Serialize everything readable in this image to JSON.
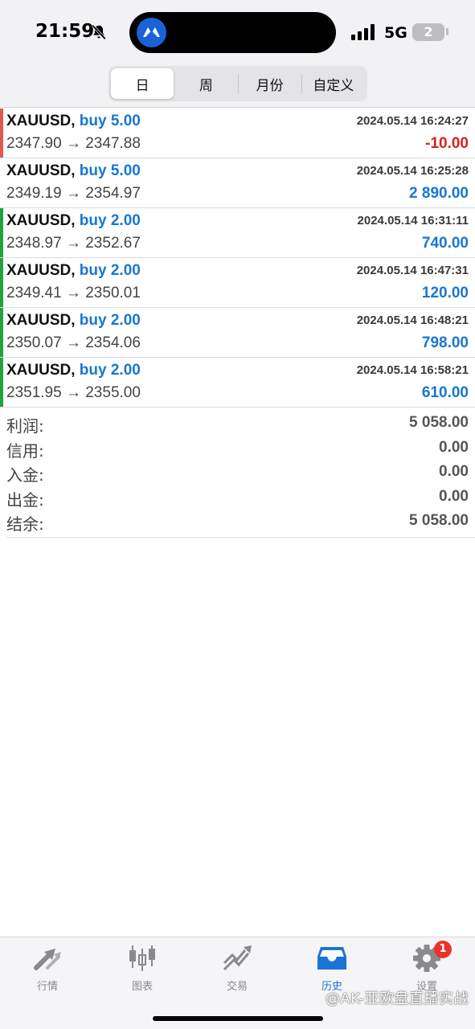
{
  "status_bar": {
    "time": "21:59",
    "network": "5G",
    "battery": "2",
    "icons": [
      "bell-slash-icon",
      "app-logo-icon",
      "signal-icon"
    ]
  },
  "period_tabs": {
    "items": [
      "日",
      "周",
      "月份",
      "自定义"
    ],
    "selected": "日"
  },
  "deals": [
    {
      "symbol": "XAUUSD,",
      "side": "buy 5.00",
      "time": "2024.05.14 16:24:27",
      "prices": "2347.90 → 2347.88",
      "profit": "-10.00",
      "bar_color": "#e05a4f",
      "negative": true
    },
    {
      "symbol": "XAUUSD,",
      "side": "buy 5.00",
      "time": "2024.05.14 16:25:28",
      "prices": "2349.19 → 2354.97",
      "profit": "2 890.00",
      "bar_color": "",
      "negative": false
    },
    {
      "symbol": "XAUUSD,",
      "side": "buy 2.00",
      "time": "2024.05.14 16:31:11",
      "prices": "2348.97 → 2352.67",
      "profit": "740.00",
      "bar_color": "#22a33a",
      "negative": false
    },
    {
      "symbol": "XAUUSD,",
      "side": "buy 2.00",
      "time": "2024.05.14 16:47:31",
      "prices": "2349.41 → 2350.01",
      "profit": "120.00",
      "bar_color": "#22a33a",
      "negative": false
    },
    {
      "symbol": "XAUUSD,",
      "side": "buy 2.00",
      "time": "2024.05.14 16:48:21",
      "prices": "2350.07 → 2354.06",
      "profit": "798.00",
      "bar_color": "#22a33a",
      "negative": false
    },
    {
      "symbol": "XAUUSD,",
      "side": "buy 2.00",
      "time": "2024.05.14 16:58:21",
      "prices": "2351.95 → 2355.00",
      "profit": "610.00",
      "bar_color": "#22a33a",
      "negative": false
    }
  ],
  "summary": [
    {
      "label": "利润:",
      "value": "5 058.00"
    },
    {
      "label": "信用:",
      "value": "0.00"
    },
    {
      "label": "入金:",
      "value": "0.00"
    },
    {
      "label": "出金:",
      "value": "0.00"
    },
    {
      "label": "结余:",
      "value": "5 058.00"
    }
  ],
  "tab_bar": {
    "items": [
      {
        "label": "行情",
        "icon": "quotes-arrows-icon"
      },
      {
        "label": "图表",
        "icon": "candlestick-chart-icon"
      },
      {
        "label": "交易",
        "icon": "trade-trend-icon"
      },
      {
        "label": "历史",
        "icon": "history-inbox-icon"
      },
      {
        "label": "设置",
        "icon": "settings-gear-icon"
      }
    ],
    "selected": "历史",
    "settings_badge": "1",
    "watermark": "@AK-亚欧盘直播实战"
  },
  "colors": {
    "accent": "#1877d2",
    "loss": "#d8211c",
    "win_bar": "#22a33a",
    "loss_bar": "#e05a4f",
    "badge": "#e8342b"
  }
}
